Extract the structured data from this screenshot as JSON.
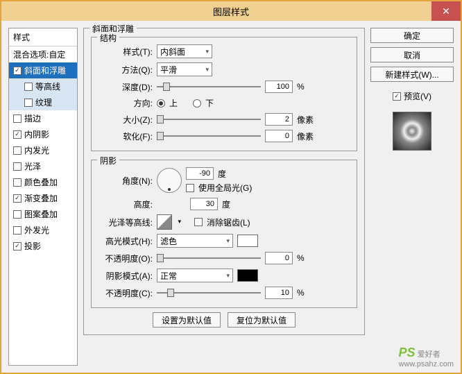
{
  "window": {
    "title": "图层样式"
  },
  "close": "✕",
  "left": {
    "header": "样式",
    "blend": "混合选项:自定",
    "items": [
      {
        "label": "斜面和浮雕",
        "checked": true,
        "selected": true
      },
      {
        "label": "等高线",
        "checked": false,
        "sub": true
      },
      {
        "label": "纹理",
        "checked": false,
        "sub": true
      },
      {
        "label": "描边",
        "checked": false
      },
      {
        "label": "内阴影",
        "checked": true
      },
      {
        "label": "内发光",
        "checked": false
      },
      {
        "label": "光泽",
        "checked": false
      },
      {
        "label": "颜色叠加",
        "checked": false
      },
      {
        "label": "渐变叠加",
        "checked": true
      },
      {
        "label": "图案叠加",
        "checked": false
      },
      {
        "label": "外发光",
        "checked": false
      },
      {
        "label": "投影",
        "checked": true
      }
    ]
  },
  "bevel": {
    "title": "斜面和浮雕",
    "structure": {
      "title": "结构",
      "style_label": "样式(T):",
      "style_value": "内斜面",
      "technique_label": "方法(Q):",
      "technique_value": "平滑",
      "depth_label": "深度(D):",
      "depth_value": "100",
      "percent": "%",
      "direction_label": "方向:",
      "up": "上",
      "down": "下",
      "size_label": "大小(Z):",
      "size_value": "2",
      "px": "像素",
      "soften_label": "软化(F):",
      "soften_value": "0"
    },
    "shading": {
      "title": "阴影",
      "angle_label": "角度(N):",
      "angle_value": "-90",
      "degree": "度",
      "global_label": "使用全局光(G)",
      "altitude_label": "高度:",
      "altitude_value": "30",
      "gloss_label": "光泽等高线:",
      "antialias_label": "消除锯齿(L)",
      "highlight_mode_label": "高光模式(H):",
      "highlight_mode_value": "滤色",
      "opacity1_label": "不透明度(O):",
      "opacity1_value": "0",
      "shadow_mode_label": "阴影模式(A):",
      "shadow_mode_value": "正常",
      "opacity2_label": "不透明度(C):",
      "opacity2_value": "10"
    }
  },
  "buttons": {
    "default": "设置为默认值",
    "reset": "复位为默认值",
    "ok": "确定",
    "cancel": "取消",
    "new": "新建样式(W)...",
    "preview": "预览(V)"
  },
  "watermark": {
    "brand": "PS",
    "text": "爱好者",
    "url": "www.psahz.com"
  }
}
